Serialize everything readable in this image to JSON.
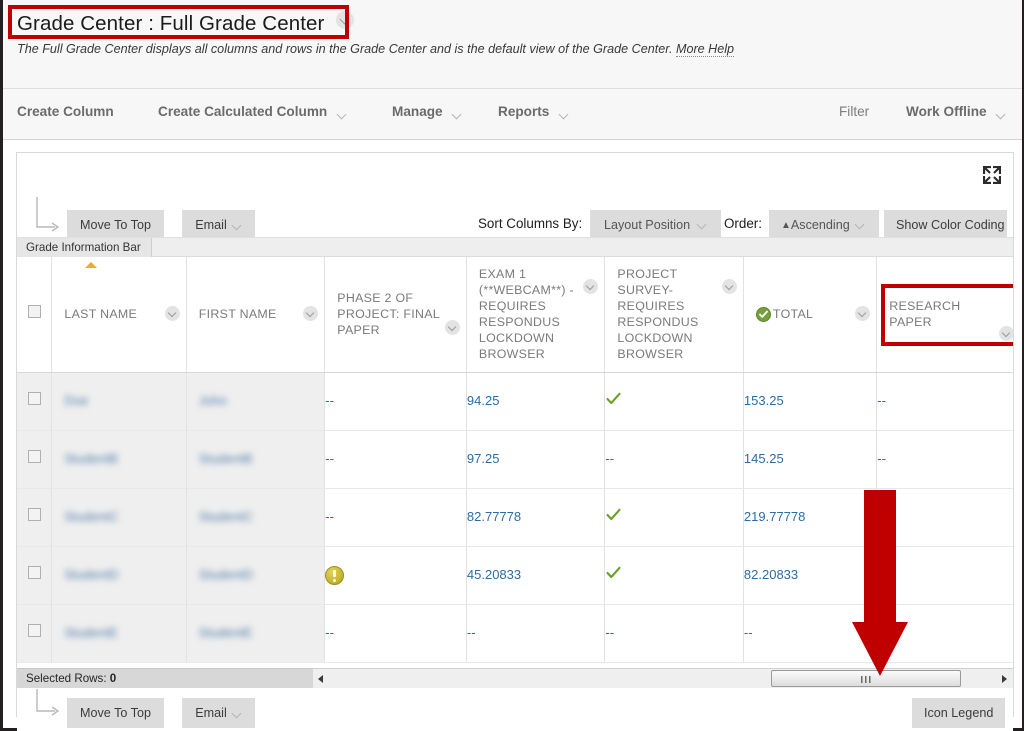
{
  "header": {
    "breadcrumb_title": "Grade Center : Full Grade Center",
    "description": "The Full Grade Center displays all columns and rows in the Grade Center and is the default view of the Grade Center.",
    "more_help": "More Help",
    "highlight_color": "#c00000"
  },
  "action_bar": {
    "items": [
      {
        "label": "Create Column",
        "has_menu": false
      },
      {
        "label": "Create Calculated Column",
        "has_menu": true
      },
      {
        "label": "Manage",
        "has_menu": true
      },
      {
        "label": "Reports",
        "has_menu": true
      }
    ],
    "right_items": [
      {
        "label": "Filter",
        "has_menu": false
      },
      {
        "label": "Work Offline",
        "has_menu": true
      }
    ]
  },
  "toolbar": {
    "move_to_top": "Move To Top",
    "email": "Email",
    "sort_columns_by_label": "Sort Columns By:",
    "sort_columns_by_value": "Layout Position",
    "order_label": "Order:",
    "order_value": "Ascending",
    "order_direction_glyph": "▲",
    "show_color_coding": "Show Color Coding",
    "expand_icon": "expand-icon"
  },
  "grade_information_bar": "Grade Information Bar",
  "table": {
    "columns": [
      {
        "key": "checkbox",
        "label": "",
        "has_menu": false,
        "icon": null
      },
      {
        "key": "last_name",
        "label": "LAST NAME",
        "has_menu": true,
        "icon": null,
        "sorted": true
      },
      {
        "key": "first_name",
        "label": "FIRST NAME",
        "has_menu": true,
        "icon": null
      },
      {
        "key": "phase2",
        "label": "PHASE 2 OF PROJECT: FINAL PAPER",
        "has_menu": true,
        "icon": null
      },
      {
        "key": "exam1",
        "label": "EXAM 1 (**WEBCAM**) - REQUIRES RESPONDUS LOCKDOWN BROWSER",
        "has_menu": true,
        "icon": null
      },
      {
        "key": "project_survey",
        "label": "PROJECT SURVEY- REQUIRES RESPONDUS LOCKDOWN BROWSER",
        "has_menu": true,
        "icon": null
      },
      {
        "key": "total",
        "label": "TOTAL",
        "has_menu": true,
        "icon": "total-check-icon"
      },
      {
        "key": "research_paper",
        "label": "RESEARCH PAPER",
        "has_menu": true,
        "icon": null,
        "highlighted": true
      }
    ],
    "rows": [
      {
        "last_name": "Doe",
        "first_name": "John",
        "phase2": "--",
        "exam1": "94.25",
        "project_survey": "check",
        "total": "153.25",
        "research_paper": "--"
      },
      {
        "last_name": "StudentB",
        "first_name": "StudentB",
        "phase2": "--",
        "exam1": "97.25",
        "project_survey": "--",
        "total": "145.25",
        "research_paper": "--"
      },
      {
        "last_name": "StudentC",
        "first_name": "StudentC",
        "phase2": "--",
        "exam1": "82.77778",
        "project_survey": "check",
        "total": "219.77778",
        "research_paper": "--"
      },
      {
        "last_name": "StudentD",
        "first_name": "StudentD",
        "phase2": "needs-grading",
        "exam1": "45.20833",
        "project_survey": "check",
        "total": "82.20833",
        "research_paper": "--"
      },
      {
        "last_name": "StudentE",
        "first_name": "StudentE",
        "phase2": "--",
        "exam1": "--",
        "project_survey": "--",
        "total": "--",
        "research_paper": "--"
      }
    ]
  },
  "status_bar": {
    "selected_rows_label": "Selected Rows:",
    "selected_rows_count": "0"
  },
  "footer": {
    "move_to_top": "Move To Top",
    "email": "Email",
    "icon_legend": "Icon Legend"
  },
  "annotations": {
    "arrow_color": "#c00000",
    "arrow_direction": "down"
  },
  "colors": {
    "value_link": "#2d6ca2",
    "header_text": "#7a7a7a",
    "check_green": "#6aa125",
    "warn_yellow": "#c8b62e",
    "annotation_red": "#c00000"
  }
}
